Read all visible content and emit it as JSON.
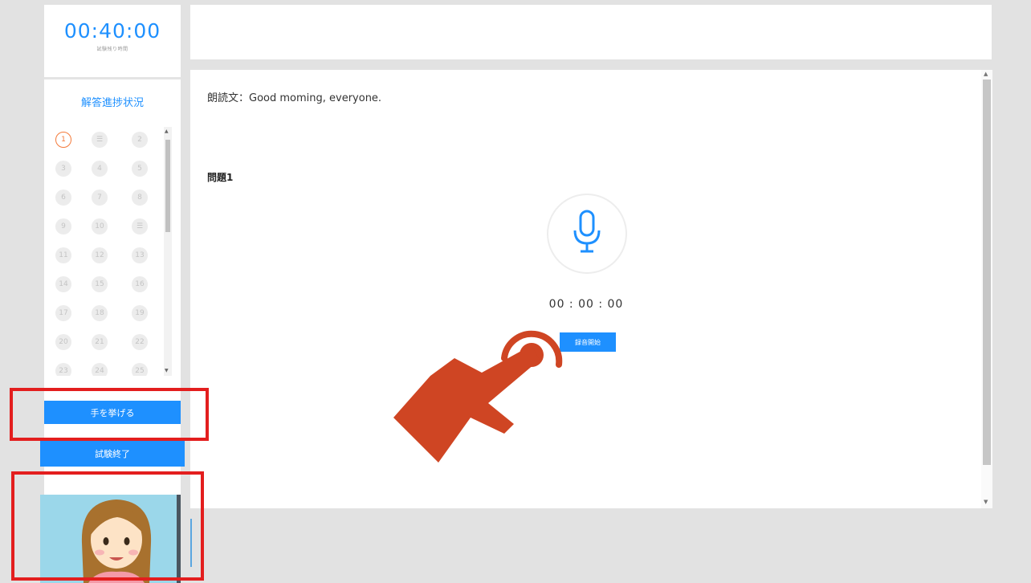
{
  "sidebar": {
    "timer": "00:40:00",
    "timer_caption": "試験残り時間",
    "progress_title": "解答進捗状況",
    "question_numbers": [
      "1",
      "☰",
      "2",
      "3",
      "4",
      "5",
      "6",
      "7",
      "8",
      "9",
      "10",
      "☰",
      "11",
      "12",
      "13",
      "14",
      "15",
      "16",
      "17",
      "18",
      "19",
      "20",
      "21",
      "22",
      "23",
      "24",
      "25"
    ],
    "current_question": "1",
    "raise_hand_label": "手を挙げる",
    "finish_exam_label": "試験終了"
  },
  "main": {
    "reading_text": "朗読文：Good moming, everyone.",
    "question_title": "問題1",
    "record_timer": "00 : 00 : 00",
    "start_record_label": "録音開始"
  },
  "icons": {
    "microphone": "microphone-icon",
    "pointer": "pointing-hand-icon",
    "avatar": "avatar-icon"
  },
  "colors": {
    "accent": "#1e90ff",
    "current_question": "#f47a3a",
    "highlight_box": "#e31e1e",
    "hand_pointer": "#cf4523"
  }
}
